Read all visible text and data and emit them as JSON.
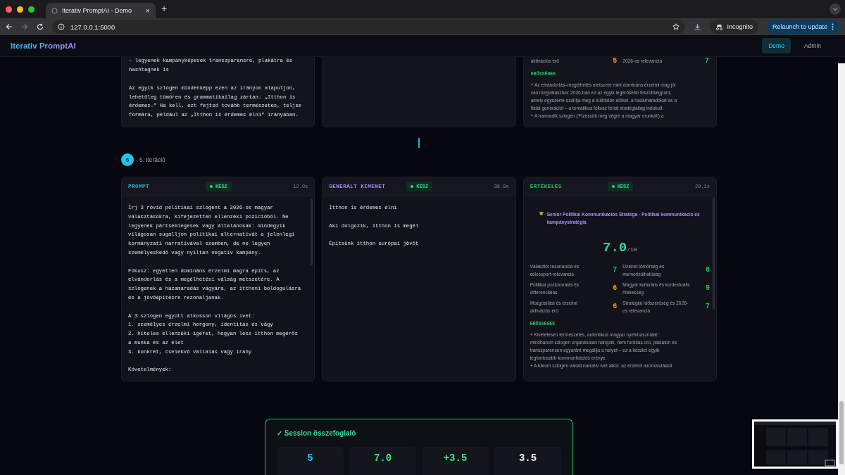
{
  "browser": {
    "tab_title": "Iterativ PromptAI - Demo",
    "tab_close": "×",
    "new_tab": "+",
    "url": "127.0.0.1:5000",
    "incognito": "Incognito",
    "relaunch": "Relaunch to update"
  },
  "header": {
    "logo": "Iterativ PromptAI",
    "nav": [
      {
        "label": "Demo",
        "selected": true
      },
      {
        "label": "Admin",
        "selected": false
      }
    ]
  },
  "previous_iteration": {
    "prompt_text": "- legyenek kampányképesek transzparensre, plakátra és\nhashtagnek is\n\nAz egyik szlogen mindenképp ezen az irányon alapuljon,\nlehetőleg tömören és grammatikailag zártan: „Itthon is\nérdemes.” Ha kell, ezt fejtsd tovább természetes, teljes\nformára, például az „Itthon is érdemes élni” irányában.",
    "metrics": [
      {
        "label": "aktivációs erő",
        "score": "5",
        "color": "#f59e0b"
      },
      {
        "label": "2026-os relevancia",
        "score": "7",
        "color": "#22c55e"
      }
    ],
    "strengths_title": "ERŐSSÉGEK",
    "strengths": "+ Az elvándorlás–megélhetés metszete mint domináns érzelmi mag jól\nvan megválasztva: 2026-ban ez az egyik legerősebb feszültségpont,\namely egyszerre szólítja meg a külföldön élőket, a hazamaradókat és a\nfiatal generációt – a tematikus fókusz tehát stratégiailag indokolt.\n+ A harmadik szlogen ('Fizessük meg végre a magyar munkát') a"
  },
  "iteration": {
    "number": "5",
    "label": "5. iteráció",
    "panels": [
      {
        "kind": "prompt",
        "title": "PROMPT",
        "color": "#22b8e0",
        "status": "KÉSZ",
        "time": "12.0s",
        "text": "Írj 3 rövid politikai szlogent a 2026-os magyar\nválasztásokra, kifejezetten ellenzéki pozícióból. Ne\nlegyenek pártsemlegesek vagy általánosak: mindegyik\nvilágosan sugalljon politikai alternatívát a jelenlegi\nkormányzati narratívával szemben, de ne legyen\nszemélyeskedő vagy nyíltan negatív kampány.\n\nFókusz: egyetlen domináns érzelmi magra építs, az\nelvándorlás és a megélhetési válság metszetére. A\nszlogenek a hazamaradás vágyára, az itthoni boldogulásra\nés a jövőépítésre rezonáljanak.\n\nA 3 szlogen együtt alkosson világos ívet:\n1. személyes érzelmi horgony, identitás és vágy\n2. hiteles ellenzéki ígéret, hogyan lesz itthon megérős\na munka és az élet\n3. konkrét, cselekvő vállalás vagy irány\n\nKövetelmények:"
      },
      {
        "kind": "output",
        "title": "GENERÁLT KIMENET",
        "color": "#a78bfa",
        "status": "KÉSZ",
        "time": "38.9s",
        "text": "Itthon is érdemes élni\n\nAki dolgozik, itthon is megél\n\nÉpítsünk itthon európai jövőt"
      },
      {
        "kind": "eval",
        "title": "ÉRTÉKELÉS",
        "color": "#22c55e",
        "status": "KÉSZ",
        "time": "29.1s",
        "persona": "Senior Politikai Kommunikációs Stratéga · Politikai kommunikáció és kampánystratégia",
        "score": "7.0",
        "score_max": "/10",
        "metrics": [
          {
            "label": "Választói rezonancia és célcsoport-relevancia",
            "score": "7",
            "color": "#22c55e"
          },
          {
            "label": "Üzenet tömörség és memorizálhatóság",
            "score": "8",
            "color": "#22c55e"
          },
          {
            "label": "Politikai pozicionálás és differenciálás",
            "score": "6",
            "color": "#f59e0b"
          },
          {
            "label": "Magyar kulturális és kontextuális hitelesség",
            "score": "9",
            "color": "#22c55e"
          },
          {
            "label": "Mozgósítási és érzelmi aktivációs erő",
            "score": "6",
            "color": "#f59e0b"
          },
          {
            "label": "Stratégiai időszerűség és 2026-os relevancia",
            "score": "7",
            "color": "#22c55e"
          }
        ],
        "strengths_title": "ERŐSSÉGEK",
        "strengths": "+ Kivételesen természetes, autentikus magyar nyelvhasználat:\nmindhárom szlogen organikusan hangzik, nem fordítás-ízű, plakáton és\ntranszparensen egyaránt megállja a helyét – ez a készlet egyik\nlegfontosabb kommunikációs erénye.\n+ A három szlogen valódi narratív ívet alkot: az érzelmi azonosulástól"
      }
    ]
  },
  "summary": {
    "check": "✓",
    "title": "Session összefoglaló",
    "stats": [
      {
        "value": "5",
        "color": "#38bdf8"
      },
      {
        "value": "7.0",
        "color": "#4ade80"
      },
      {
        "value": "+3.5",
        "color": "#4ade80"
      },
      {
        "value": "3.5",
        "color": "#f1f5f9"
      }
    ]
  }
}
